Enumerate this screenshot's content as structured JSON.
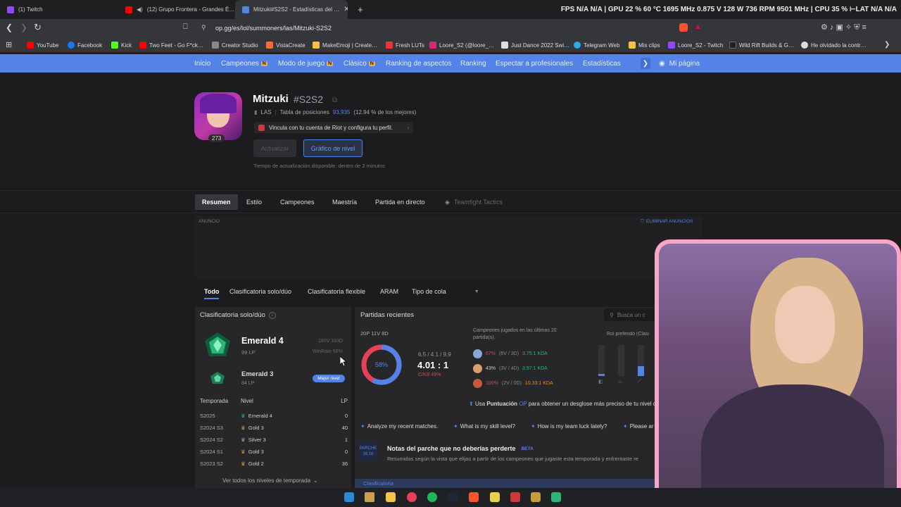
{
  "browser": {
    "tabs": [
      "(1) Twitch",
      "(12) Grupo Frontera - Grandes É…",
      "Mitzuki#S2S2 - Estadísticas del …"
    ],
    "perf": "FPS  N/A  N/A  |  GPU  22 %  60 °C  1695 MHz  0.875 V  128 W  736 RPM  9501 MHz  |  CPU  35 %  ⊢LAT  N/A  N/A",
    "url": "op.gg/es/lol/summoners/las/Mitzuki-S2S2",
    "bookmarks": [
      "YouTube",
      "Facebook",
      "Kick",
      "Two Feet - Go F*ck…",
      "Creator Studio",
      "VistaCreate",
      "MakeEmoji | Create…",
      "Fresh LUTs",
      "Loore_S2 (@loore_…",
      "Just Dance 2022 Swi…",
      "Telegram Web",
      "Mis clips",
      "Loore_S2 - Twitch",
      "Wild Rift Builds & G…",
      "He olvidado la contr…"
    ]
  },
  "site_nav": {
    "items": [
      "Inicio",
      "Campeones",
      "Modo de juego",
      "Clásico",
      "Ranking de aspectos",
      "Ranking",
      "Espectar a profesionales",
      "Estadísticas"
    ],
    "badge": "N",
    "my_page": "Mi página"
  },
  "profile": {
    "name": "Mitzuki",
    "tag": "#S2S2",
    "level": "273",
    "region": "LAS",
    "ladder_label": "Tabla de posiciones",
    "ladder_rank": "93,935",
    "ladder_pct": "(12.94 % de los mejores)",
    "riot_link": "Vincula con tu cuenta de Riot y configura tu perfil.",
    "update_btn": "Actualizar",
    "graph_btn": "Gráfico de nivel",
    "update_note": "Tiempo de actualización disponible: dentro de 2 minutos"
  },
  "profile_tabs": [
    "Resumen",
    "Estilo",
    "Campeones",
    "Maestría",
    "Partida en directo",
    "Teamfight Tactics"
  ],
  "ad": {
    "label": "ANUNCIO",
    "remove": "ELIMINAR ANUNCIOS"
  },
  "queue_tabs": [
    "Todo",
    "Clasificatoria solo/dúo",
    "Clasificatoria flexible",
    "ARAM",
    "Tipo de cola"
  ],
  "ranked": {
    "title": "Clasificatoria solo/dúo",
    "tier": "Emerald 4",
    "lp": "99 LP",
    "wl": "180V 183D",
    "winrate": "WinRate 50%",
    "peak_tier": "Emerald 3",
    "peak_lp": "84 LP",
    "peak_badge": "Mejor nivel",
    "headers": [
      "Temporada",
      "Nivel",
      "LP"
    ],
    "seasons": [
      {
        "season": "S2025",
        "tier": "Emerald 4",
        "lp": "0",
        "color": "#2bb574"
      },
      {
        "season": "S2024 S3",
        "tier": "Gold 3",
        "lp": "40",
        "color": "#c9a24a"
      },
      {
        "season": "S2024 S2",
        "tier": "Silver 3",
        "lp": "1",
        "color": "#9aa7b0"
      },
      {
        "season": "S2024 S1",
        "tier": "Gold 3",
        "lp": "0",
        "color": "#c9a24a"
      },
      {
        "season": "S2023 S2",
        "tier": "Gold 2",
        "lp": "36",
        "color": "#c9a24a"
      }
    ],
    "view_all": "Ver todos los niveles de temporada"
  },
  "recent": {
    "title": "Partidas recientes",
    "search_placeholder": "Busca un c",
    "summary": "20P 11V 8D",
    "winrate": 58,
    "winrate_label": "58%",
    "kda_line": "6.5 / 4.1 / 9.9",
    "kda": "4.01 : 1",
    "kp": "C/Kill 49%",
    "champs_title": "Campeones jugados en las últimas 20 partida(s).",
    "champs": [
      {
        "wr": "67%",
        "rec": "(6V / 3D)",
        "kda": "3.75:1 KDA",
        "wrColor": "#e84057",
        "kdaColor": "#2bb574",
        "c": "#8aa6d6"
      },
      {
        "wr": "43%",
        "rec": "(3V / 4D)",
        "kda": "3.97:1 KDA",
        "wrColor": "#cccccc",
        "kdaColor": "#2bb574",
        "c": "#d8a06a"
      },
      {
        "wr": "100%",
        "rec": "(2V / 0D)",
        "kda": "10.33:1 KDA",
        "wrColor": "#e84057",
        "kdaColor": "#ff8200",
        "c": "#c65b3a"
      }
    ],
    "role_title": "Rol preferido (Clasi",
    "op_score_pre": "Usa",
    "op_score_bold": "Puntuación",
    "op_score_op": "OP",
    "op_score_post": "para obtener un desglose más preciso de tu nivel d",
    "ai_pills": [
      "Analyze my recent matches.",
      "What is my skill level?",
      "How is my team luck lately?",
      "Please ar"
    ],
    "patch_label": "PARCHE 16.16",
    "patch_title": "Notas del parche que no deberías perderte",
    "patch_beta": "BETA",
    "patch_desc": "Resumidas según la vista que elijas a partir de los campeones que jugaste esta temporada y enfrentaste re",
    "bottom": "Clasificatoria"
  },
  "colors": {
    "accent": "#5383e8",
    "win": "#5383e8",
    "loss": "#e84057",
    "emerald": "#2bb574"
  }
}
